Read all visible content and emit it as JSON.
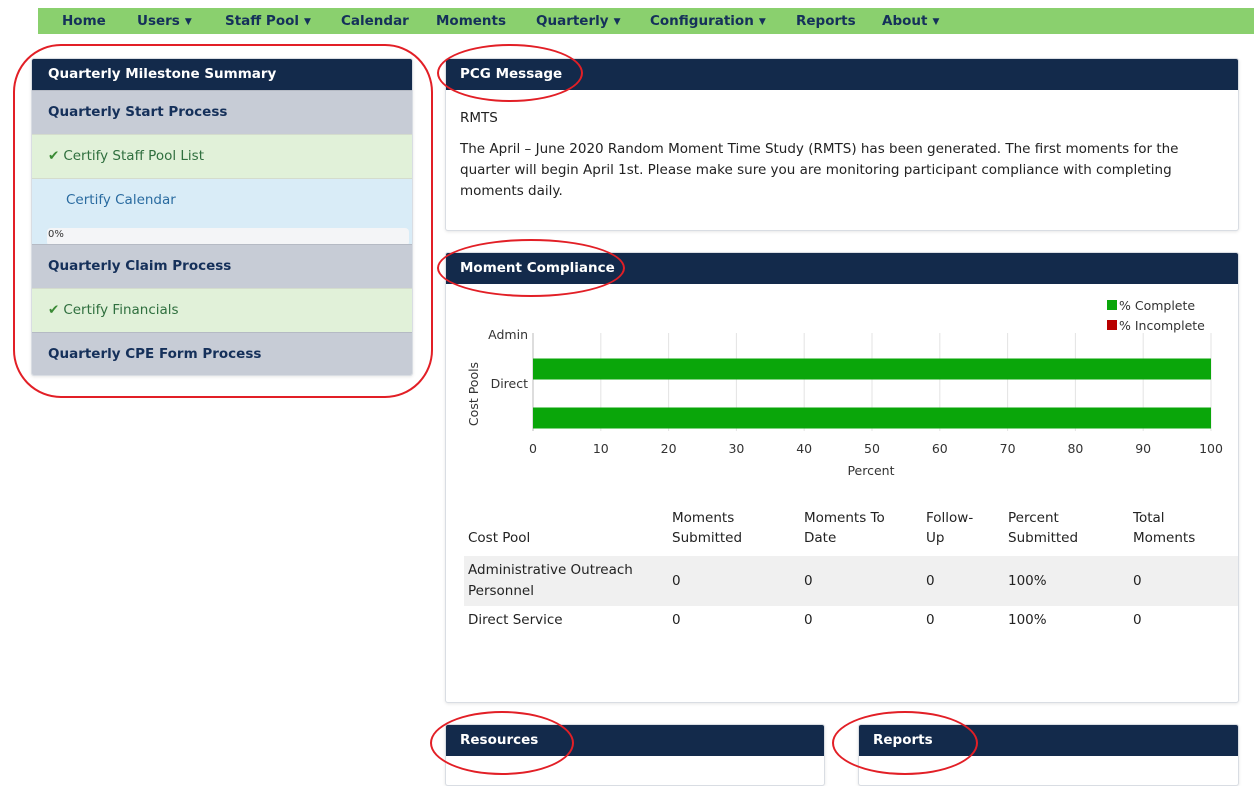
{
  "nav": [
    {
      "label": "Home",
      "dropdown": false
    },
    {
      "label": "Users",
      "dropdown": true
    },
    {
      "label": "Staff Pool",
      "dropdown": true
    },
    {
      "label": "Calendar",
      "dropdown": false
    },
    {
      "label": "Moments",
      "dropdown": false
    },
    {
      "label": "Quarterly",
      "dropdown": true
    },
    {
      "label": "Configuration",
      "dropdown": true
    },
    {
      "label": "Reports",
      "dropdown": false
    },
    {
      "label": "About",
      "dropdown": true
    }
  ],
  "milestones": {
    "title": "Quarterly Milestone Summary",
    "start_process": "Quarterly Start Process",
    "certify_staff_pool": "Certify Staff Pool List",
    "certify_calendar": "Certify Calendar",
    "calendar_progress": "0%",
    "calendar_progress_value": 0,
    "claim_process": "Quarterly Claim Process",
    "certify_financials": "Certify Financials",
    "cpe_process": "Quarterly CPE Form Process"
  },
  "pcg": {
    "title": "PCG Message",
    "subject": "RMTS",
    "line1": "The April – June 2020 Random Moment Time Study (RMTS) has been generated. The first moments for the",
    "line2": "quarter will begin April 1st. Please make sure you are monitoring participant compliance with completing",
    "line3": "moments daily."
  },
  "compliance": {
    "title": "Moment Compliance"
  },
  "chart_data": {
    "type": "bar",
    "orientation": "horizontal",
    "categories": [
      "Admin",
      "Direct"
    ],
    "series": [
      {
        "name": "% Complete",
        "color": "#0aa60a",
        "values": [
          100,
          100
        ]
      },
      {
        "name": "% Incomplete",
        "color": "#b80000",
        "values": [
          0,
          0
        ]
      }
    ],
    "xlabel": "Percent",
    "ylabel": "Cost Pools",
    "xlim": [
      0,
      100
    ],
    "xticks": [
      0,
      10,
      20,
      30,
      40,
      50,
      60,
      70,
      80,
      90,
      100
    ],
    "grid": true,
    "legend": "top-right",
    "stacked": true
  },
  "table": {
    "headers": {
      "cost_pool": "Cost Pool",
      "submitted_1": "Moments",
      "submitted_2": "Submitted",
      "to_date_1": "Moments To",
      "to_date_2": "Date",
      "followup_1": "Follow-",
      "followup_2": "Up",
      "percent_1": "Percent",
      "percent_2": "Submitted",
      "total_1": "Total",
      "total_2": "Moments"
    },
    "rows": [
      {
        "pool_1": "Administrative Outreach",
        "pool_2": "Personnel",
        "submitted": "0",
        "to_date": "0",
        "followup": "0",
        "percent": "100%",
        "total": "0"
      },
      {
        "pool_1": "Direct Service",
        "pool_2": "",
        "submitted": "0",
        "to_date": "0",
        "followup": "0",
        "percent": "100%",
        "total": "0"
      }
    ]
  },
  "resources": {
    "title": "Resources"
  },
  "reports": {
    "title": "Reports"
  }
}
